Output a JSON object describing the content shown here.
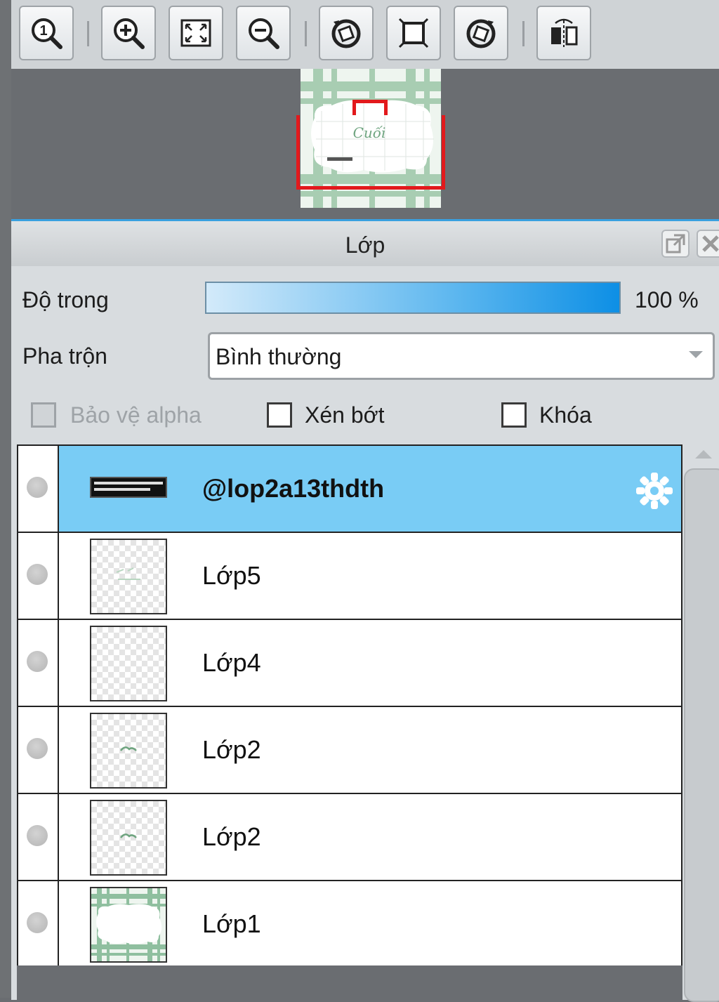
{
  "toolbar": {
    "buttons": [
      {
        "name": "actual-size",
        "icon": "zoom-actual-size-icon"
      },
      {
        "name": "zoom-in",
        "icon": "zoom-in-icon"
      },
      {
        "name": "fit-to-window",
        "icon": "fit-to-window-icon"
      },
      {
        "name": "zoom-out",
        "icon": "zoom-out-icon"
      },
      {
        "name": "rotate-left",
        "icon": "rotate-left-icon"
      },
      {
        "name": "reset-rotation",
        "icon": "reset-view-icon"
      },
      {
        "name": "rotate-right",
        "icon": "rotate-right-icon"
      },
      {
        "name": "flip-horizontal",
        "icon": "flip-horizontal-icon"
      }
    ]
  },
  "layer_panel": {
    "title": "Lớp",
    "opacity_label": "Độ trong",
    "opacity_value": "100 %",
    "opacity_fraction": 1.0,
    "blend_label": "Pha trộn",
    "blend_value": "Bình thường",
    "protect_alpha_label": "Bảo vệ alpha",
    "clipping_label": "Xén bớt",
    "lock_label": "Khóa",
    "protect_alpha_checked": false,
    "clipping_checked": false,
    "lock_checked": false,
    "layers": [
      {
        "name": "@lop2a13thdth",
        "selected": true,
        "thumb": "text"
      },
      {
        "name": "Lớp5",
        "selected": false,
        "thumb": "transparent-faint"
      },
      {
        "name": "Lớp4",
        "selected": false,
        "thumb": "transparent"
      },
      {
        "name": "Lớp2",
        "selected": false,
        "thumb": "transparent-logo"
      },
      {
        "name": "Lớp2",
        "selected": false,
        "thumb": "transparent-logo"
      },
      {
        "name": "Lớp1",
        "selected": false,
        "thumb": "plaid-background"
      }
    ]
  },
  "colors": {
    "selected_row": "#79ccf5",
    "accent": "#3aa0df",
    "navigator_frame": "#e2191c",
    "plaid_green": "#8fbf9f"
  }
}
